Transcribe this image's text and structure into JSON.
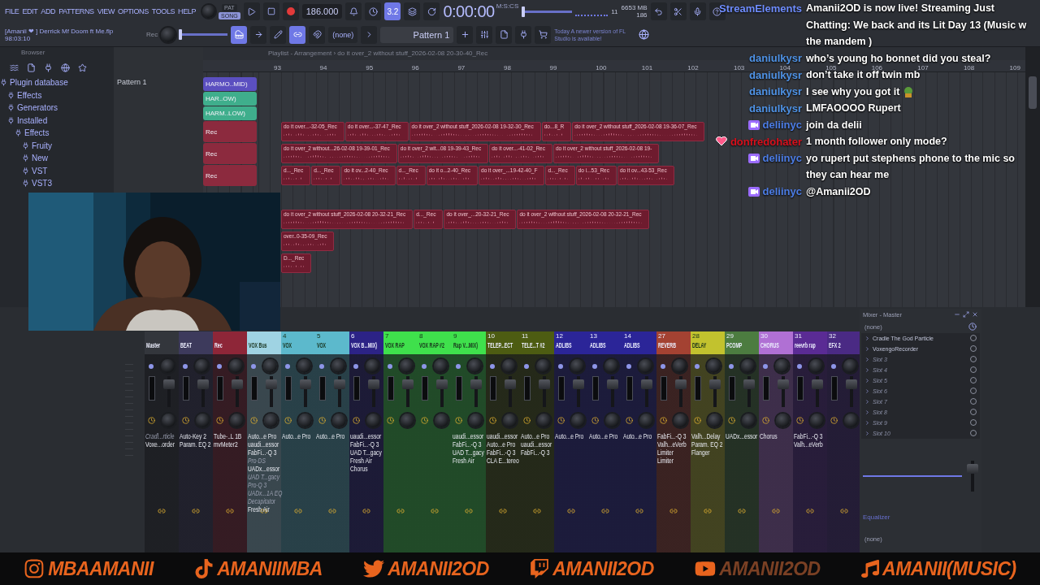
{
  "toolbar": {
    "menu": [
      "FILE",
      "EDIT",
      "ADD",
      "PATTERNS",
      "VIEW",
      "OPTIONS",
      "TOOLS",
      "HELP"
    ],
    "mode": [
      {
        "label": "PAT",
        "selected": false
      },
      {
        "label": "SONG",
        "selected": true
      }
    ],
    "song_position": {
      "level": 0
    },
    "pitch": {
      "level": 0
    },
    "tempo": "186.000",
    "snap": "3.2",
    "time_format": "M:S:CS",
    "time": "0:00:00",
    "cpu": "11",
    "memory": "6653 MB",
    "polyphony": "186",
    "project": "[Amanii ❤ ] Derrick Mf Doom ft Me.flp",
    "elapsed": "98:03:10",
    "rec": "Rec",
    "channel": "(none)",
    "pattern": "Pattern 1",
    "hint_day": "Today",
    "hint": "A newer version of FL Studio is available!"
  },
  "browser": {
    "title": "Browser",
    "tree": [
      {
        "label": "Plugin database",
        "children": [
          {
            "label": "Effects"
          },
          {
            "label": "Generators"
          },
          {
            "label": "Installed",
            "children": [
              {
                "label": "Effects",
                "children": [
                  {
                    "label": "Fruity"
                  },
                  {
                    "label": "New"
                  },
                  {
                    "label": "VST"
                  },
                  {
                    "label": "VST3"
                  }
                ]
              }
            ]
          }
        ]
      }
    ]
  },
  "patterns": [
    "Pattern 1"
  ],
  "playlist": {
    "title": "Playlist - Arrangement › do it over_2 without stuff_2026-02-08 20-30-40_Rec",
    "ruler": [
      "93",
      "94",
      "95",
      "96",
      "97",
      "98",
      "99",
      "100",
      "101",
      "102",
      "103",
      "104",
      "105",
      "106",
      "107",
      "108",
      "109"
    ],
    "lanes": [
      {
        "label": "HARMO..MID)",
        "color": "#5b4fc0",
        "kind": "midi"
      },
      {
        "label": "HAR..OW)",
        "color": "#3fae8c",
        "kind": "midi"
      },
      {
        "label": "HARM..LOW)",
        "color": "#3fae8c",
        "kind": "midi"
      },
      {
        "label": "Rec",
        "color": "#8c2a3e",
        "kind": "audio",
        "clips": [
          "do it over...-32-05_Rec",
          "do it over...-37-47_Rec",
          "do it over_2 without stuff_2026-02-08 19-32-30_Rec",
          "do...8_R",
          "do it over_2 without stuff_2026-02-08 19-36-07_Rec"
        ]
      },
      {
        "label": "Rec",
        "color": "#8c2a3e",
        "kind": "audio",
        "clips": [
          "do it over_2 without...26-02-08 19-39-01_Rec",
          "do it over_2 wit...08 19-39-43_Rec",
          "do it over...-41-02_Rec",
          "do it over_2 without stuff_2026-02-08 19-"
        ]
      },
      {
        "label": "Rec",
        "color": "#8c2a3e",
        "kind": "audio",
        "clips": [
          "d..._Rec",
          "d..._Rec",
          "do it ov...2-40_Rec",
          "d..._Rec",
          "do it o...2-40_Rec",
          "do it over_...19-42-40_F",
          "d..._Rec",
          "do i...53_Rec",
          "do it ov...43-53_Rec"
        ]
      },
      {
        "kind": "audio"
      },
      {
        "kind": "audio",
        "clips": [
          "do it over_2 without stuff_2026-02-08 20-32-21_Rec",
          "d..._Rec",
          "do it over_...20-32-21_Rec",
          "do it over_2 without stuff_2026-02-08 20-32-21_Rec"
        ]
      },
      {
        "kind": "audio",
        "clips": [
          "over..0-35-09_Rec"
        ]
      },
      {
        "kind": "audio",
        "clips": [
          "D..._Rec"
        ]
      }
    ]
  },
  "mixer": {
    "strips": [
      {
        "name": "Master",
        "color": "#33363c",
        "plugins": [
          {
            "name": "Cradl...rticle",
            "enabled": false
          },
          {
            "name": "Voxe...order",
            "enabled": true
          }
        ]
      },
      {
        "name": "BEAT",
        "color": "#3d3a5c",
        "plugins": [
          {
            "name": "Auto-Key 2",
            "enabled": true
          },
          {
            "name": "Param. EQ 2",
            "enabled": true
          }
        ]
      },
      {
        "name": "Rec",
        "color": "#8e2638",
        "plugins": [
          {
            "name": "Tube-..L 1B",
            "enabled": true
          },
          {
            "name": "mvMeter2",
            "enabled": true
          }
        ]
      },
      {
        "name": "VOX Bus",
        "color": "#9fd3e3",
        "plugins": [
          {
            "name": "Auto...e Pro",
            "enabled": true
          },
          {
            "name": "uaudi...essor",
            "enabled": true
          },
          {
            "name": "FabFi...-Q 3",
            "enabled": true
          },
          {
            "name": "Pro-DS",
            "enabled": false
          },
          {
            "name": "UADx...essor",
            "enabled": true
          },
          {
            "name": "UAD T...gacy",
            "enabled": false
          },
          {
            "name": "Pro-Q 3",
            "enabled": false
          },
          {
            "name": "UADx...1A EQ",
            "enabled": false
          },
          {
            "name": "Decapitator",
            "enabled": false
          },
          {
            "name": "Fresh Air",
            "enabled": true
          }
        ]
      },
      {
        "number": "4",
        "name": "VOX",
        "color": "#5cb9cc",
        "plugins": [
          {
            "name": "Auto...e Pro",
            "enabled": true
          }
        ]
      },
      {
        "number": "5",
        "name": "VOX",
        "color": "#5cb9cc",
        "plugins": [
          {
            "name": "Auto...e Pro",
            "enabled": true
          }
        ]
      },
      {
        "number": "6",
        "name": "VOX B...MIX)",
        "color": "#2c2386",
        "plugins": [
          {
            "name": "uaudi...essor",
            "enabled": true
          },
          {
            "name": "FabFi...-Q 3",
            "enabled": true
          },
          {
            "name": "UAD T...gacy",
            "enabled": true
          },
          {
            "name": "Fresh Air",
            "enabled": true
          },
          {
            "name": "Chorus",
            "enabled": true
          }
        ]
      },
      {
        "number": "7",
        "name": "VOX RAP",
        "color": "#3fe04c"
      },
      {
        "number": "8",
        "name": "VOX RAP #2",
        "color": "#3fe04c"
      },
      {
        "number": "9",
        "name": "Rap V...MIX)",
        "color": "#3fe04c",
        "plugins": [
          {
            "name": "uaudi...essor",
            "enabled": true
          },
          {
            "name": "FabFi...-Q 3",
            "enabled": true
          },
          {
            "name": "UAD T...gacy",
            "enabled": true
          },
          {
            "name": "Fresh Air",
            "enabled": true
          }
        ]
      },
      {
        "number": "10",
        "name": "TELEP...ECT",
        "color": "#4d5c12",
        "plugins": [
          {
            "name": "uaudi...essor",
            "enabled": true
          },
          {
            "name": "Auto...e Pro",
            "enabled": true
          },
          {
            "name": "FabFi...-Q 3",
            "enabled": true
          },
          {
            "name": "CLA E...tereo",
            "enabled": true
          }
        ]
      },
      {
        "number": "11",
        "name": "TELE...T #2",
        "color": "#4d5c12",
        "plugins": [
          {
            "name": "Auto...e Pro",
            "enabled": true
          },
          {
            "name": "uaudi...essor",
            "enabled": true
          },
          {
            "name": "FabFi...-Q 3",
            "enabled": true
          }
        ]
      },
      {
        "number": "12",
        "name": "ADLIBS",
        "color": "#2b2598",
        "plugins": [
          {
            "name": "Auto...e Pro",
            "enabled": true
          }
        ]
      },
      {
        "number": "13",
        "name": "ADLIBS",
        "color": "#2b2598",
        "plugins": [
          {
            "name": "Auto...e Pro",
            "enabled": true
          }
        ]
      },
      {
        "number": "14",
        "name": "ADLIBS",
        "color": "#2b2598",
        "plugins": [
          {
            "name": "Auto...e Pro",
            "enabled": true
          }
        ]
      },
      {
        "number": "27",
        "name": "REVERB",
        "color": "#a44232",
        "plugins": [
          {
            "name": "FabFi...-Q 3",
            "enabled": true
          },
          {
            "name": "Valh...eVerb",
            "enabled": true
          },
          {
            "name": "Limiter",
            "enabled": true
          },
          {
            "name": "Limiter",
            "enabled": true
          }
        ]
      },
      {
        "number": "28",
        "name": "DELAY",
        "color": "#c2c22e",
        "plugins": [
          {
            "name": "Valh...Delay",
            "enabled": true
          },
          {
            "name": "Param. EQ 2",
            "enabled": true
          },
          {
            "name": "Flanger",
            "enabled": true
          }
        ]
      },
      {
        "number": "29",
        "name": "PCOMP",
        "color": "#4c7c40",
        "plugins": [
          {
            "name": "UADx...essor",
            "enabled": true
          }
        ]
      },
      {
        "number": "30",
        "name": "CHORUS",
        "color": "#b070d4",
        "plugins": [
          {
            "name": "Chorus",
            "enabled": true
          }
        ]
      },
      {
        "number": "31",
        "name": "reevrb rap",
        "color": "#5a2b94",
        "plugins": [
          {
            "name": "FabFi...-Q 3",
            "enabled": true
          },
          {
            "name": "Valh...eVerb",
            "enabled": true
          }
        ]
      },
      {
        "number": "32",
        "name": "EFX 2",
        "color": "#4a2a84"
      }
    ],
    "panel": {
      "title": "Mixer - Master",
      "input": "(none)",
      "slots": [
        {
          "name": "Cradle The God Particle",
          "empty": false
        },
        {
          "name": "VoxengoRecorder",
          "empty": false
        },
        {
          "name": "Slot 3",
          "empty": true
        },
        {
          "name": "Slot 4",
          "empty": true
        },
        {
          "name": "Slot 5",
          "empty": true
        },
        {
          "name": "Slot 6",
          "empty": true
        },
        {
          "name": "Slot 7",
          "empty": true
        },
        {
          "name": "Slot 8",
          "empty": true
        },
        {
          "name": "Slot 9",
          "empty": true
        },
        {
          "name": "Slot 10",
          "empty": true
        }
      ],
      "eq_label": "Equalizer",
      "output": "(none)"
    }
  },
  "chat": [
    {
      "name": "StreamElements",
      "color": "#6f8dff",
      "kind": "plain",
      "text": "Amanii2OD is now live! Streaming Just Chatting: We back and its Lit Day 13 (Music w the mandem )"
    },
    {
      "name": "daniulkysr",
      "color": "#4f93e6",
      "kind": "plain",
      "text": "who’s young ho bonnet did you steal?"
    },
    {
      "name": "daniulkysr",
      "color": "#4f93e6",
      "kind": "plain",
      "text": "don’t take it off twin mb"
    },
    {
      "name": "daniulkysr",
      "color": "#4f93e6",
      "kind": "plain",
      "emote": true,
      "text": "I see why you got it"
    },
    {
      "name": "daniulkysr",
      "color": "#4f93e6",
      "kind": "plain",
      "text": "LMFAOOOO Rupert"
    },
    {
      "name": "deliinyc",
      "color": "#4c7de6",
      "kind": "sub",
      "text": "join da delii"
    },
    {
      "name": "donfredohater",
      "color": "#d8101c",
      "kind": "heart",
      "text": "1 month follower only mode?"
    },
    {
      "name": "deliinyc",
      "color": "#4c7de6",
      "kind": "sub",
      "text": "yo rupert put stephens phone to the mic so they can hear me"
    },
    {
      "name": "deliinyc",
      "color": "#4c7de6",
      "kind": "sub",
      "text": "@Amanii2OD"
    }
  ],
  "socials": [
    {
      "kind": "instagram",
      "handle": "MBAAMANII",
      "faded": false
    },
    {
      "kind": "tiktok",
      "handle": "AMANIIMBA",
      "faded": false
    },
    {
      "kind": "twitter",
      "handle": "AMANII2OD",
      "faded": false
    },
    {
      "kind": "twitch",
      "handle": "AMANII2OD",
      "faded": false
    },
    {
      "kind": "youtube",
      "handle": "AMANII2OD",
      "faded": true
    },
    {
      "kind": "music",
      "handle": "AMANII(MUSIC)",
      "faded": false
    }
  ]
}
